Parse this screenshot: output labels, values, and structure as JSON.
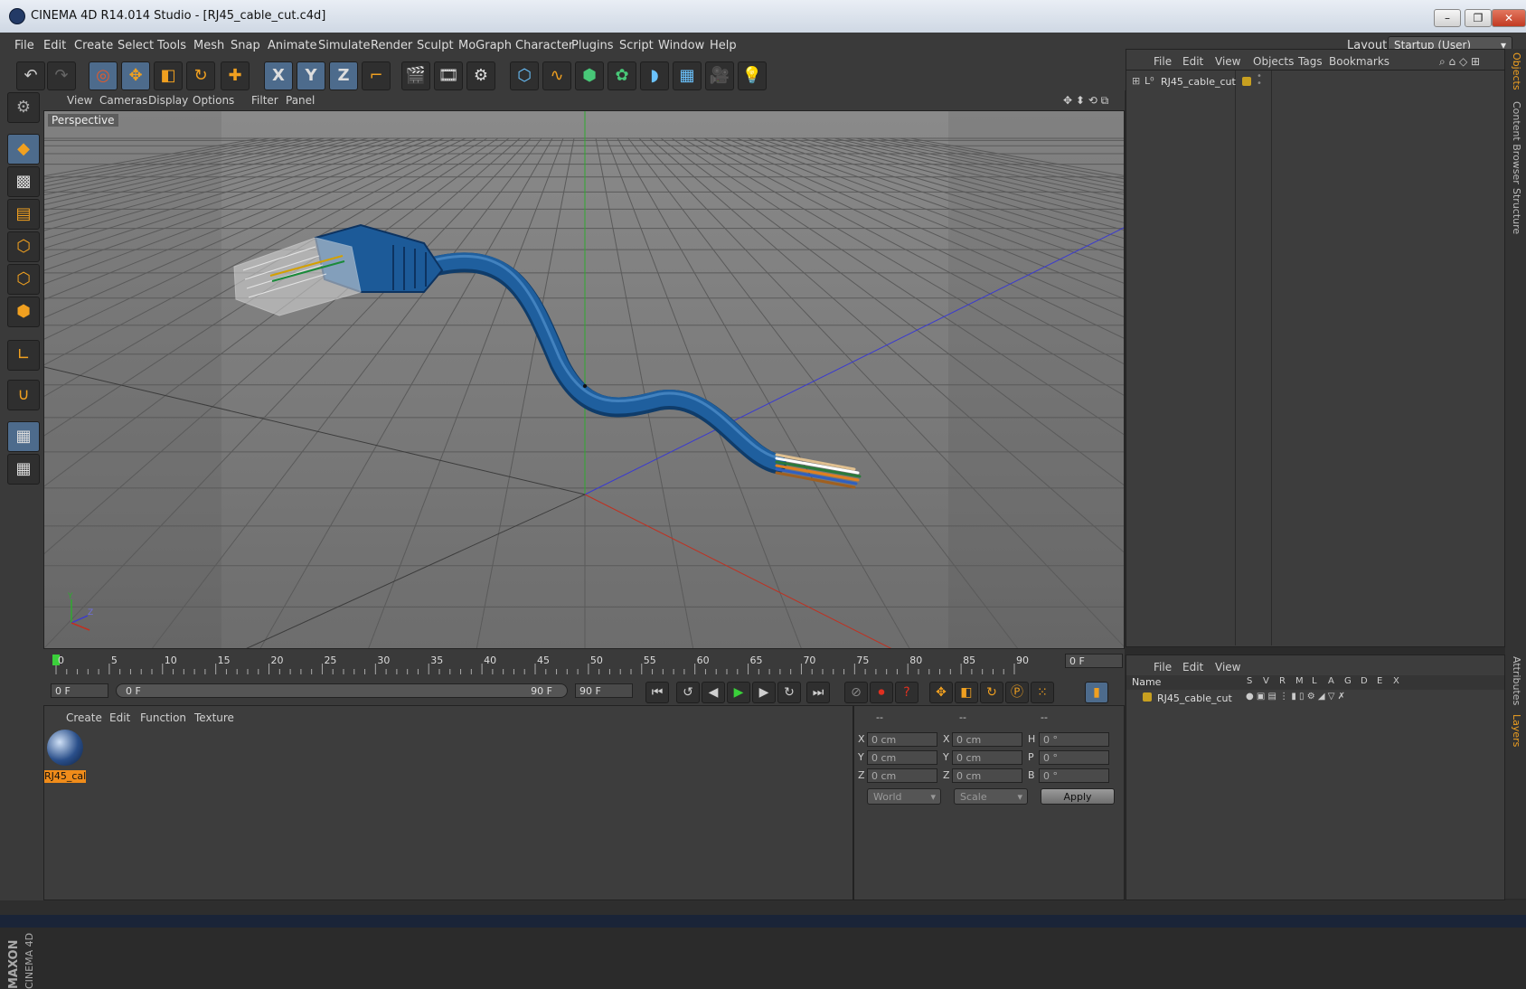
{
  "window": {
    "title": "CINEMA 4D R14.014 Studio - [RJ45_cable_cut.c4d]",
    "controls": {
      "minimize": "–",
      "restore": "❐",
      "close": "✕"
    }
  },
  "menu": [
    "File",
    "Edit",
    "Create",
    "Select",
    "Tools",
    "Mesh",
    "Snap",
    "Animate",
    "Simulate",
    "Render",
    "Sculpt",
    "MoGraph",
    "Character",
    "Plugins",
    "Script",
    "Window",
    "Help"
  ],
  "layout": {
    "label": "Layout:",
    "value": "Startup (User)"
  },
  "toolbar": {
    "icons": [
      "undo-icon",
      "redo-icon",
      "live-selection-icon",
      "move-icon",
      "scale-icon",
      "rotate-icon",
      "move-plus-icon",
      "x-axis-icon",
      "y-axis-icon",
      "z-axis-icon",
      "coordinate-system-icon",
      "render-view-icon",
      "render-picture-viewer-icon",
      "render-settings-icon",
      "cube-icon",
      "spline-icon",
      "subdivision-icon",
      "cloner-icon",
      "deformer-icon",
      "floor-icon",
      "camera-icon",
      "light-icon"
    ],
    "axis_labels": [
      "X",
      "Y",
      "Z"
    ]
  },
  "viewport": {
    "menu": [
      "View",
      "Cameras",
      "Display",
      "Options",
      "Filter",
      "Panel"
    ],
    "label": "Perspective",
    "axis": {
      "y": "Y",
      "z": "Z"
    }
  },
  "timeline": {
    "ticks": [
      "0",
      "5",
      "10",
      "15",
      "20",
      "25",
      "30",
      "35",
      "40",
      "45",
      "50",
      "55",
      "60",
      "65",
      "70",
      "75",
      "80",
      "85",
      "90"
    ],
    "current_frame": "0 F"
  },
  "transport": {
    "start": "0 F",
    "range_start": "0 F",
    "range_end": "90 F",
    "end": "90 F"
  },
  "materials": {
    "menu": [
      "Create",
      "Edit",
      "Function",
      "Texture"
    ],
    "items": [
      {
        "label": "RJ45_cal"
      }
    ]
  },
  "coordinates": {
    "headers": [
      "--",
      "--",
      "--"
    ],
    "rows": [
      {
        "l1": "X",
        "v1": "0 cm",
        "l2": "X",
        "v2": "0 cm",
        "l3": "H",
        "v3": "0 °"
      },
      {
        "l1": "Y",
        "v1": "0 cm",
        "l2": "Y",
        "v2": "0 cm",
        "l3": "P",
        "v3": "0 °"
      },
      {
        "l1": "Z",
        "v1": "0 cm",
        "l2": "Z",
        "v2": "0 cm",
        "l3": "B",
        "v3": "0 °"
      }
    ],
    "mode": "World",
    "scale": "Scale",
    "apply": "Apply"
  },
  "objects": {
    "menu": [
      "File",
      "Edit",
      "View",
      "Objects",
      "Tags",
      "Bookmarks"
    ],
    "items": [
      {
        "name": "RJ45_cable_cut",
        "color": "#c8a020"
      }
    ]
  },
  "layers": {
    "menu": [
      "File",
      "Edit",
      "View"
    ],
    "name_header": "Name",
    "flags": [
      "S",
      "V",
      "R",
      "M",
      "L",
      "A",
      "G",
      "D",
      "E",
      "X"
    ],
    "items": [
      {
        "name": "RJ45_cable_cut"
      }
    ]
  },
  "side_tabs": {
    "top": [
      "Objects",
      "Content Browser",
      "Structure"
    ],
    "bottom": [
      "Attributes",
      "Layers"
    ]
  },
  "branding": {
    "maxon": "MAXON",
    "product": "CINEMA 4D"
  },
  "colors": {
    "accent": "#f08c1a",
    "selected": "#4d6b8c",
    "cable": "#1f5f9e"
  }
}
